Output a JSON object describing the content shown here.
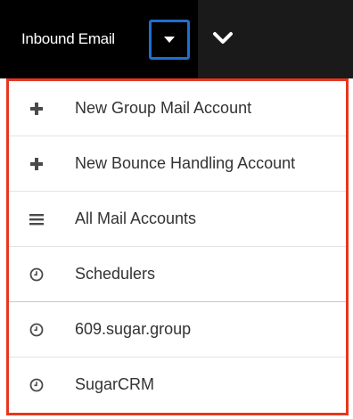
{
  "nav": {
    "active_tab_label": "Inbound Email"
  },
  "menu": {
    "items": [
      {
        "icon": "plus-icon",
        "label": "New Group Mail Account"
      },
      {
        "icon": "plus-icon",
        "label": "New Bounce Handling Account"
      },
      {
        "icon": "list-icon",
        "label": "All Mail Accounts"
      },
      {
        "icon": "clock-icon",
        "label": "Schedulers"
      },
      {
        "icon": "clock-icon",
        "label": "609.sugar.group"
      },
      {
        "icon": "clock-icon",
        "label": "SugarCRM"
      }
    ]
  },
  "colors": {
    "highlight_border": "#e8361f",
    "focus_ring": "#1f6fcf",
    "nav_background": "#000000"
  }
}
